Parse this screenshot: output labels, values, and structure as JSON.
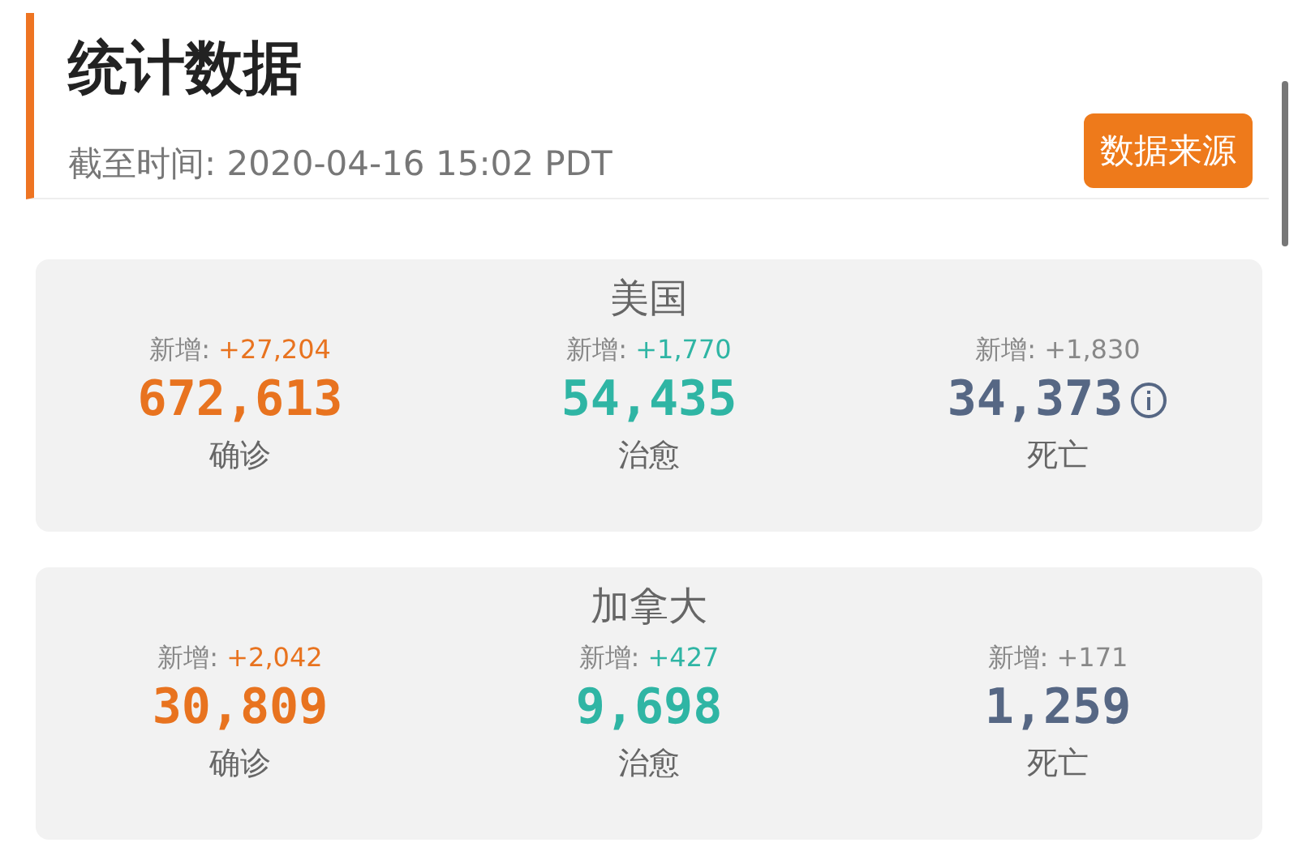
{
  "header": {
    "title": "统计数据",
    "updated": "截至时间: 2020-04-16 15:02 PDT",
    "source_button": "数据来源"
  },
  "regions": [
    {
      "name": "美国",
      "stats": [
        {
          "kind": "confirmed",
          "new_label": "新增:",
          "new_value": "+27,204",
          "total": "672,613",
          "label": "确诊",
          "info": false
        },
        {
          "kind": "recovered",
          "new_label": "新增:",
          "new_value": "+1,770",
          "total": "54,435",
          "label": "治愈",
          "info": false
        },
        {
          "kind": "deaths",
          "new_label": "新增:",
          "new_value": "+1,830",
          "total": "34,373",
          "label": "死亡",
          "info": true
        }
      ]
    },
    {
      "name": "加拿大",
      "stats": [
        {
          "kind": "confirmed",
          "new_label": "新增:",
          "new_value": "+2,042",
          "total": "30,809",
          "label": "确诊",
          "info": false
        },
        {
          "kind": "recovered",
          "new_label": "新增:",
          "new_value": "+427",
          "total": "9,698",
          "label": "治愈",
          "info": false
        },
        {
          "kind": "deaths",
          "new_label": "新增:",
          "new_value": "+171",
          "total": "1,259",
          "label": "死亡",
          "info": false
        }
      ]
    }
  ]
}
